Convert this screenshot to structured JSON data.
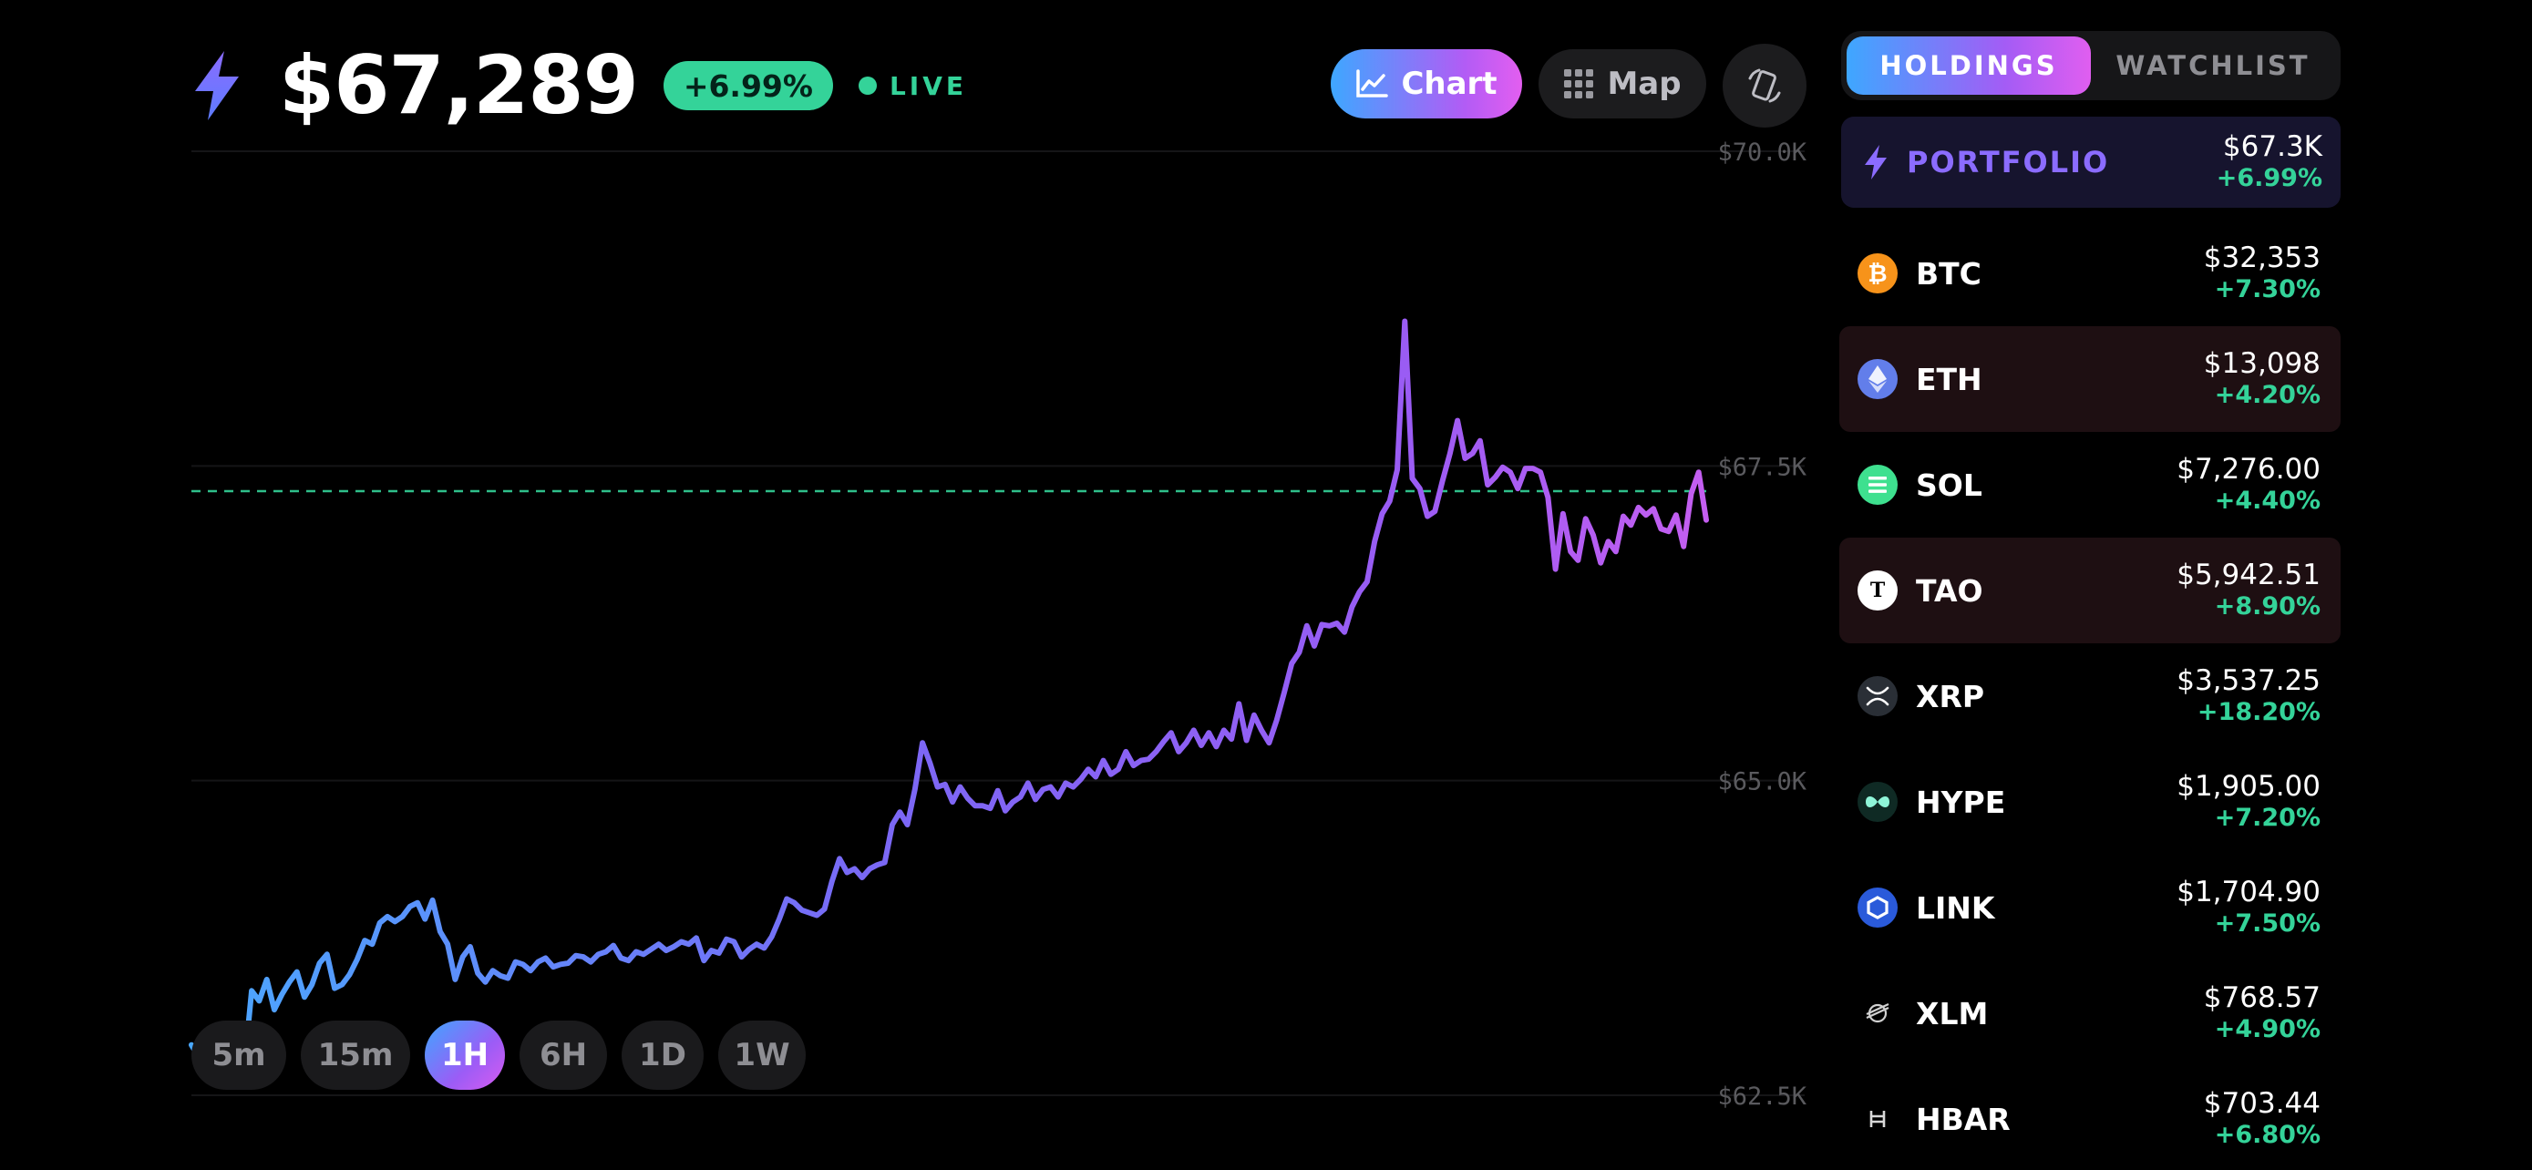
{
  "header": {
    "price": "$67,289",
    "change": "+6.99%",
    "live_label": "LIVE",
    "logo_icon": "lightning-bolt-icon"
  },
  "view_toggle": {
    "chart_label": "Chart",
    "map_label": "Map",
    "chart_icon": "line-chart-icon",
    "map_icon": "grid-icon",
    "rotate_icon": "rotate-device-icon"
  },
  "timeframes": [
    "5m",
    "15m",
    "1H",
    "6H",
    "1D",
    "1W"
  ],
  "active_timeframe": "1H",
  "chart_data": {
    "type": "line",
    "title": "",
    "xlabel": "",
    "ylabel": "",
    "y_ticks": [
      "$70.0K",
      "$67.5K",
      "$65.0K",
      "$62.5K"
    ],
    "ylim": [
      62500,
      70000
    ],
    "reference_line": 67300,
    "series": [
      {
        "values": [
          62900,
          62800,
          62760,
          62850,
          62780,
          62700,
          62900,
          62720,
          63330,
          63250,
          63420,
          63180,
          63300,
          63400,
          63480,
          63280,
          63380,
          63550,
          63620,
          63350,
          63380,
          63460,
          63580,
          63730,
          63700,
          63870,
          63920,
          63880,
          63920,
          64000,
          64030,
          63900,
          64050,
          63800,
          63700,
          63420,
          63600,
          63680,
          63470,
          63400,
          63490,
          63450,
          63430,
          63560,
          63540,
          63490,
          63560,
          63590,
          63520,
          63540,
          63550,
          63610,
          63600,
          63560,
          63620,
          63640,
          63690,
          63590,
          63570,
          63640,
          63620,
          63660,
          63700,
          63650,
          63680,
          63720,
          63700,
          63750,
          63570,
          63650,
          63630,
          63740,
          63720,
          63600,
          63660,
          63700,
          63670,
          63760,
          63900,
          64060,
          64030,
          63970,
          63950,
          63930,
          63980,
          64200,
          64380,
          64270,
          64300,
          64230,
          64300,
          64330,
          64350,
          64650,
          64750,
          64650,
          64930,
          65300,
          65140,
          64950,
          64970,
          64830,
          64950,
          64860,
          64800,
          64800,
          64780,
          64920,
          64760,
          64830,
          64870,
          64980,
          64850,
          64930,
          64950,
          64870,
          64980,
          64950,
          65010,
          65090,
          65030,
          65160,
          65050,
          65090,
          65230,
          65120,
          65160,
          65170,
          65230,
          65310,
          65380,
          65230,
          65300,
          65400,
          65280,
          65380,
          65270,
          65400,
          65330,
          65610,
          65320,
          65520,
          65400,
          65300,
          65480,
          65700,
          65930,
          66020,
          66230,
          66070,
          66240,
          66230,
          66250,
          66180,
          66380,
          66500,
          66580,
          66900,
          67120,
          67220,
          67470,
          68650,
          67400,
          67320,
          67100,
          67140,
          67380,
          67600,
          67860,
          67560,
          67600,
          67700,
          67350,
          67410,
          67490,
          67450,
          67320,
          67480,
          67480,
          67450,
          67250,
          66680,
          67120,
          66820,
          66750,
          67080,
          66950,
          66730,
          66900,
          66820,
          67100,
          67030,
          67170,
          67110,
          67160,
          67000,
          66980,
          67110,
          66860,
          67280,
          67450,
          67070
        ]
      }
    ]
  },
  "tabs": {
    "holdings": "HOLDINGS",
    "watchlist": "WATCHLIST",
    "active": "HOLDINGS"
  },
  "portfolio": {
    "label": "PORTFOLIO",
    "value": "$67.3K",
    "change": "+6.99%",
    "icon": "lightning-bolt-icon"
  },
  "holdings": [
    {
      "symbol": "BTC",
      "value": "$32,353",
      "change": "+7.30%",
      "icon": "bitcoin-icon",
      "color": "#f7931a"
    },
    {
      "symbol": "ETH",
      "value": "$13,098",
      "change": "+4.20%",
      "icon": "ethereum-icon",
      "color": "#627eea"
    },
    {
      "symbol": "SOL",
      "value": "$7,276.00",
      "change": "+4.40%",
      "icon": "solana-icon",
      "color": "#3ee08f"
    },
    {
      "symbol": "TAO",
      "value": "$5,942.51",
      "change": "+8.90%",
      "icon": "bittensor-icon",
      "color": "#ffffff"
    },
    {
      "symbol": "XRP",
      "value": "$3,537.25",
      "change": "+18.20%",
      "icon": "xrp-icon",
      "color": "#23292f"
    },
    {
      "symbol": "HYPE",
      "value": "$1,905.00",
      "change": "+7.20%",
      "icon": "hyperliquid-icon",
      "color": "#0f2a24"
    },
    {
      "symbol": "LINK",
      "value": "$1,704.90",
      "change": "+7.50%",
      "icon": "chainlink-icon",
      "color": "#2a5ada"
    },
    {
      "symbol": "XLM",
      "value": "$768.57",
      "change": "+4.90%",
      "icon": "stellar-icon",
      "color": "#000000"
    },
    {
      "symbol": "HBAR",
      "value": "$703.44",
      "change": "+6.80%",
      "icon": "hedera-icon",
      "color": "#000000"
    }
  ],
  "colors": {
    "accent_green": "#34d399",
    "accent_purple": "#8b6cff",
    "gradient_start": "#3ea7ff",
    "gradient_end": "#e05ef0",
    "highlight_row": "#1e0f12"
  }
}
